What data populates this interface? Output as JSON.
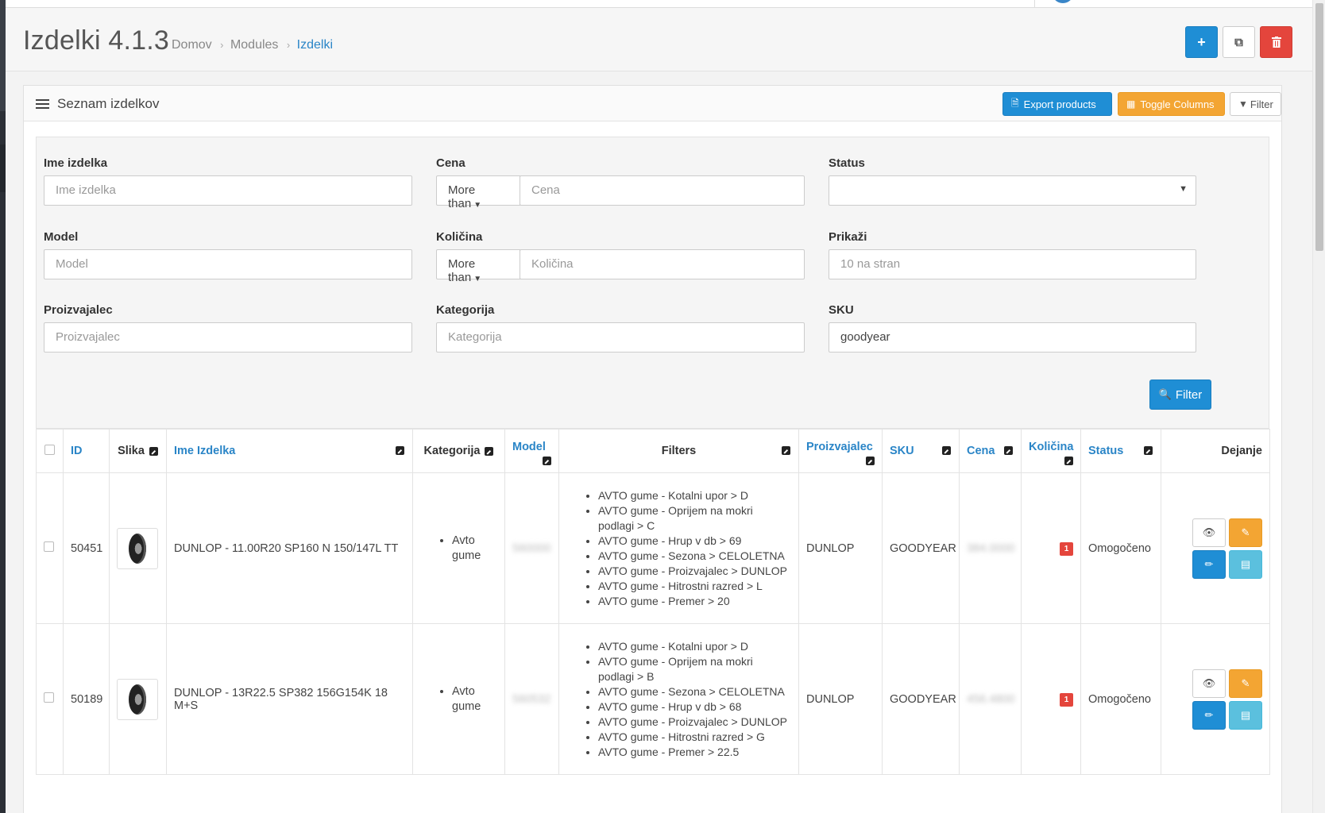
{
  "header": {
    "title": "Izdelki 4.1.3",
    "breadcrumb": [
      "Domov",
      "Modules",
      "Izdelki"
    ]
  },
  "panel": {
    "title": "Seznam izdelkov",
    "export_label": "Export products",
    "toggle_label": "Toggle Columns",
    "filter_label": "Filter"
  },
  "filters": {
    "name": {
      "label": "Ime izdelka",
      "placeholder": "Ime izdelka",
      "value": ""
    },
    "price": {
      "label": "Cena",
      "operator": "More than",
      "placeholder": "Cena",
      "value": ""
    },
    "status": {
      "label": "Status",
      "value": ""
    },
    "model": {
      "label": "Model",
      "placeholder": "Model",
      "value": ""
    },
    "quantity": {
      "label": "Količina",
      "operator": "More than",
      "placeholder": "Količina",
      "value": ""
    },
    "show": {
      "label": "Prikaži",
      "placeholder": "10 na stran",
      "value": ""
    },
    "manufacturer": {
      "label": "Proizvajalec",
      "placeholder": "Proizvajalec",
      "value": ""
    },
    "category": {
      "label": "Kategorija",
      "placeholder": "Kategorija",
      "value": ""
    },
    "sku": {
      "label": "SKU",
      "placeholder": "",
      "value": "goodyear"
    },
    "submit_label": "Filter"
  },
  "table": {
    "columns": {
      "id": "ID",
      "image": "Slika",
      "name": "Ime Izdelka",
      "category": "Kategorija",
      "model": "Model",
      "filters": "Filters",
      "manufacturer": "Proizvajalec",
      "sku": "SKU",
      "price": "Cena",
      "quantity": "Količina",
      "status": "Status",
      "actions": "Dejanje"
    },
    "rows": [
      {
        "id": "50451",
        "name": "DUNLOP - 11.00R20 SP160 N 150/147L TT",
        "category": "Avto gume",
        "model": "560000",
        "filters": [
          "AVTO gume - Kotalni upor > D",
          "AVTO gume - Oprijem na mokri podlagi > C",
          "AVTO gume - Hrup v db > 69",
          "AVTO gume - Sezona > CELOLETNA",
          "AVTO gume - Proizvajalec > DUNLOP",
          "AVTO gume - Hitrostni razred > L",
          "AVTO gume - Premer > 20"
        ],
        "manufacturer": "DUNLOP",
        "sku": "GOODYEAR",
        "price": "384.0000",
        "quantity": "1",
        "status": "Omogočeno"
      },
      {
        "id": "50189",
        "name": "DUNLOP - 13R22.5 SP382 156G154K 18 M+S",
        "category": "Avto gume",
        "model": "560532",
        "filters": [
          "AVTO gume - Kotalni upor > D",
          "AVTO gume - Oprijem na mokri podlagi > B",
          "AVTO gume - Sezona > CELOLETNA",
          "AVTO gume - Hrup v db > 68",
          "AVTO gume - Proizvajalec > DUNLOP",
          "AVTO gume - Hitrostni razred > G",
          "AVTO gume - Premer > 22.5"
        ],
        "manufacturer": "DUNLOP",
        "sku": "GOODYEAR",
        "price": "456.4800",
        "quantity": "1",
        "status": "Omogočeno"
      }
    ]
  },
  "colors": {
    "primary": "#1f8ed5",
    "warning": "#f3a533",
    "danger": "#e4453c",
    "info": "#5bc0de"
  }
}
